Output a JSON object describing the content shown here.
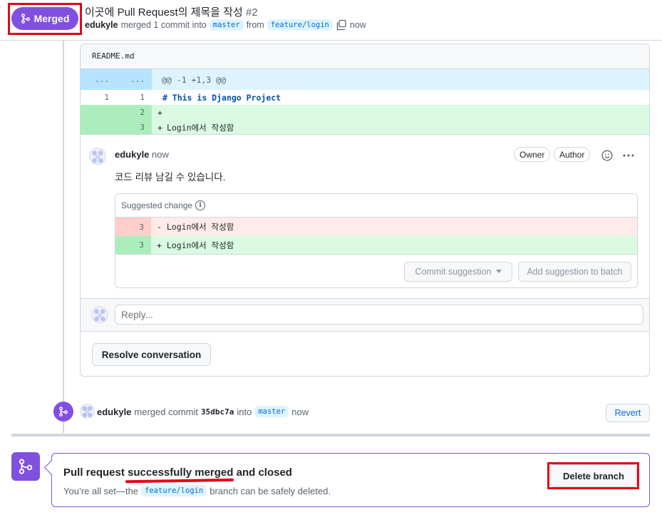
{
  "header": {
    "status_badge": "Merged",
    "title": "이곳에 Pull Request의 제목을 작성",
    "number": "#2",
    "author": "edukyle",
    "merged_text": "merged 1 commit into",
    "base_branch": "master",
    "from_text": "from",
    "head_branch": "feature/login",
    "time": "now"
  },
  "diff": {
    "file_name": "README.md",
    "hunk_old": "...",
    "hunk_new": "...",
    "hunk_header": "@@ -1 +1,3 @@",
    "lines": [
      {
        "old": "1",
        "new": "1",
        "sign": " ",
        "text": "# This is Django Project"
      },
      {
        "old": "",
        "new": "2",
        "sign": "+",
        "text": ""
      },
      {
        "old": "",
        "new": "3",
        "sign": "+",
        "text": "Login에서 작성함"
      }
    ]
  },
  "comment": {
    "author": "edukyle",
    "time": "now",
    "owner_label": "Owner",
    "author_label": "Author",
    "body": "코드 리뷰 남길 수 있습니다.",
    "suggestion": {
      "header": "Suggested change",
      "del_line_no": "3",
      "del_text": "- Login에서 작성함",
      "add_line_no": "3",
      "add_text": "+ Login에서 작성함",
      "commit_button": "Commit suggestion",
      "batch_button": "Add suggestion to batch"
    },
    "reply_placeholder": "Reply...",
    "resolve_button": "Resolve conversation"
  },
  "merge_event": {
    "author": "edukyle",
    "text": "merged commit",
    "sha": "35dbc7a",
    "into_text": "into",
    "branch": "master",
    "time": "now",
    "revert_button": "Revert"
  },
  "merged_box": {
    "title_prefix": "Pull request",
    "title_emphasis": "successfully merged",
    "title_suffix": "and closed",
    "sub_prefix": "You’re all set—the",
    "branch": "feature/login",
    "sub_suffix": "branch can be safely deleted.",
    "delete_button": "Delete branch"
  },
  "colors": {
    "merged_purple": "#8250df",
    "highlight_red": "#e3001b",
    "link_blue": "#0969da"
  }
}
